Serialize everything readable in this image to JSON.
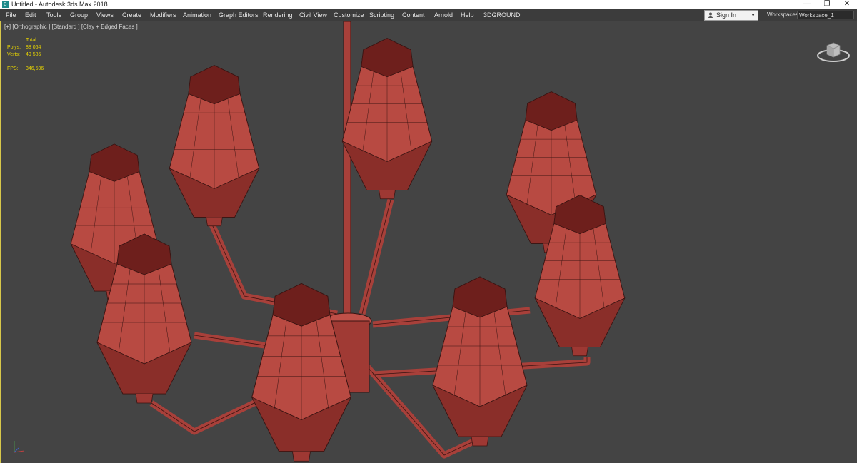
{
  "window": {
    "title": "Untitled - Autodesk 3ds Max 2018",
    "minimize_glyph": "—",
    "restore_glyph": "❐",
    "close_glyph": "✕"
  },
  "menu": {
    "items": [
      "File",
      "Edit",
      "Tools",
      "Group",
      "Views",
      "Create",
      "Modifiers",
      "Animation",
      "Graph Editors",
      "Rendering",
      "Civil View",
      "Customize",
      "Scripting",
      "Content",
      "Arnold",
      "Help",
      "3DGROUND"
    ]
  },
  "account": {
    "sign_in_label": "Sign In"
  },
  "workspaces": {
    "label": "Workspaces:",
    "selected": "Workspace_1"
  },
  "viewport": {
    "label": "[+] [Orthographic ] [Standard ] [Clay + Edged Faces ]",
    "stats": {
      "header": "Total",
      "polys_label": "Polys:",
      "polys_value": "88 064",
      "verts_label": "Verts:",
      "verts_value": "49 585",
      "fps_label": "FPS:",
      "fps_value": "346,596"
    }
  },
  "colors": {
    "viewport_bg": "#444444",
    "viewport_border": "#d7c74a",
    "model_fill": "#b0403a",
    "model_wire": "#3a1412",
    "stats_text": "#e8d400"
  },
  "icons": {
    "app": "3ds-max-app-icon",
    "user": "user-icon",
    "viewcube": "viewcube-icon",
    "axis": "axis-tripod-icon"
  }
}
